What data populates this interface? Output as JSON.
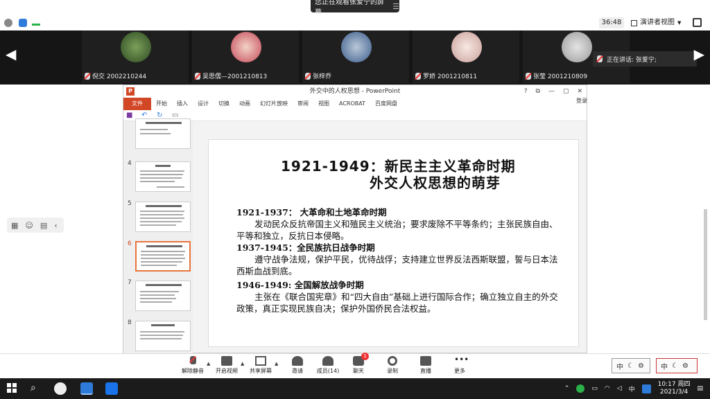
{
  "share_banner": {
    "text": "您正在观看张爱宁的屏幕"
  },
  "meeting": {
    "timer": "36:48",
    "view_label": "演讲者视图"
  },
  "participants": [
    {
      "name": "倪交 2002210244"
    },
    {
      "name": "吴思儒—2001210813"
    },
    {
      "name": "张梓乔"
    },
    {
      "name": "罗娇 2001210811"
    },
    {
      "name": "张莹 2001210809"
    }
  ],
  "speaking": {
    "label": "正在讲话: 张爱宁;"
  },
  "ppt": {
    "window_title": "外交中的人权思想 - PowerPoint",
    "winctl": [
      "?",
      "⧉",
      "—",
      "▢",
      "✕"
    ],
    "ribbon_tabs": [
      "文件",
      "开始",
      "插入",
      "设计",
      "切换",
      "动画",
      "幻灯片放映",
      "审阅",
      "视图",
      "ACROBAT",
      "百度网盘"
    ],
    "login": "登录",
    "thumb_numbers": [
      "4",
      "5",
      "6",
      "7",
      "8"
    ],
    "slide": {
      "title_line1": "1921-1949：新民主主义革命时期",
      "title_line2": "外交人权思想的萌芽",
      "sections": [
        {
          "heading": "1921-1937：  大革命和土地革命时期",
          "body": "发动民众反抗帝国主义和殖民主义统治；要求废除不平等条约；主张民族自由、平等和独立，反抗日本侵略。"
        },
        {
          "heading": "1937-1945：全民族抗日战争时期",
          "body": "遵守战争法规，保护平民，优待战俘；支持建立世界反法西斯联盟，誓与日本法西斯血战到底。"
        },
        {
          "heading": "1946-1949:   全国解放战争时期",
          "body": "主张在《联合国宪章》和“四大自由”基础上进行国际合作；确立独立自主的外交政策，真正实现民族自决；保护外国侨民合法权益。"
        }
      ]
    }
  },
  "toolbar": {
    "unmute": "解除静音",
    "start_video": "开启视频",
    "share_screen": "共享屏幕",
    "invite": "邀请",
    "members": "成员(14)",
    "chat": "聊天",
    "chat_badge": "1",
    "record": "录制",
    "live": "直播",
    "more": "更多"
  },
  "ime": {
    "label1": "中",
    "label2": "中"
  },
  "taskbar": {
    "tray_lang": "中",
    "time": "10:17 周四",
    "date": "2021/3/4"
  },
  "colors": {
    "ppt_accent": "#d24726",
    "thumb_active": "#e8743b",
    "strip_bg": "#151515"
  }
}
